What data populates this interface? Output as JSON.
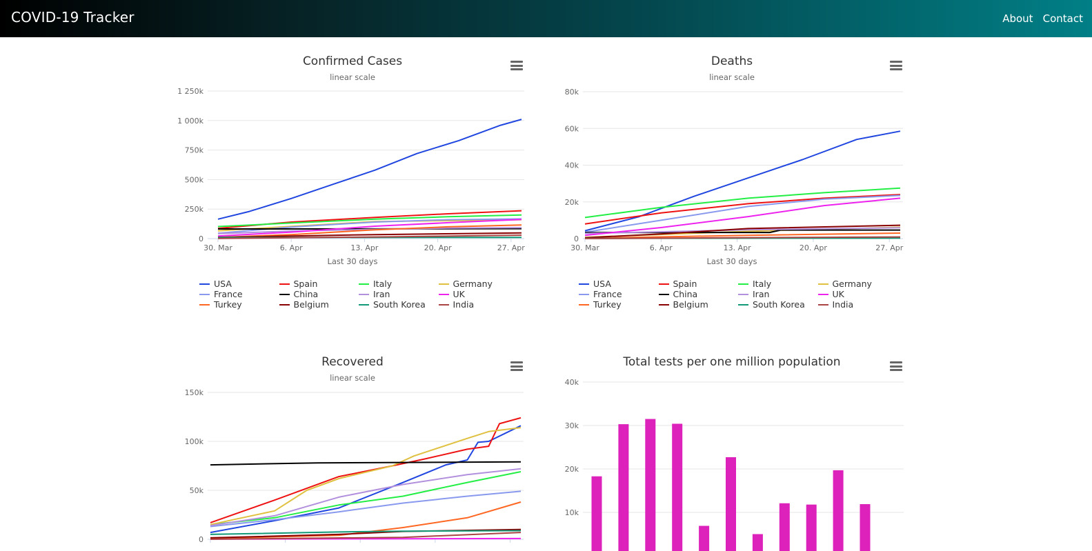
{
  "navbar": {
    "brand": "COVID-19 Tracker",
    "links": [
      "About",
      "Contact"
    ],
    "gradient": [
      "#000000",
      "#017f86"
    ]
  },
  "charts": {
    "confirmed": {
      "title": "Confirmed Cases",
      "subtitle": "linear scale",
      "xlabel": "Last 30 days"
    },
    "deaths": {
      "title": "Deaths",
      "subtitle": "linear scale",
      "xlabel": "Last 30 days"
    },
    "recovered": {
      "title": "Recovered",
      "subtitle": "linear scale"
    },
    "tests": {
      "title": "Total tests per one million population"
    }
  },
  "legend": [
    {
      "name": "USA",
      "color": "#2046e0"
    },
    {
      "name": "Spain",
      "color": "#ee1111"
    },
    {
      "name": "Italy",
      "color": "#22ee44"
    },
    {
      "name": "Germany",
      "color": "#e0c040"
    },
    {
      "name": "France",
      "color": "#8899ee"
    },
    {
      "name": "China",
      "color": "#000000"
    },
    {
      "name": "Iran",
      "color": "#b290dd"
    },
    {
      "name": "UK",
      "color": "#ee22ee"
    },
    {
      "name": "Turkey",
      "color": "#ff6622"
    },
    {
      "name": "Belgium",
      "color": "#880000"
    },
    {
      "name": "South Korea",
      "color": "#119977"
    },
    {
      "name": "India",
      "color": "#aa4444"
    }
  ],
  "chart_data": [
    {
      "type": "line",
      "title": "Confirmed Cases",
      "subtitle": "linear scale",
      "xlabel": "Last 30 days",
      "ylabel": "",
      "x_ticks": [
        "30. Mar",
        "6. Apr",
        "13. Apr",
        "20. Apr",
        "27. Apr"
      ],
      "y_ticks": [
        "0",
        "250k",
        "500k",
        "750k",
        "1 000k",
        "1 250k"
      ],
      "ylim": [
        0,
        1250000
      ],
      "legend_position": "bottom",
      "series": [
        {
          "name": "USA",
          "color": "#2046e0",
          "points": [
            [
              0,
              165000
            ],
            [
              3,
              230000
            ],
            [
              7,
              340000
            ],
            [
              11,
              460000
            ],
            [
              15,
              580000
            ],
            [
              19,
              720000
            ],
            [
              23,
              830000
            ],
            [
              27,
              960000
            ],
            [
              29,
              1010000
            ]
          ]
        },
        {
          "name": "Spain",
          "color": "#ee1111",
          "points": [
            [
              0,
              87000
            ],
            [
              7,
              140000
            ],
            [
              15,
              180000
            ],
            [
              22,
              210000
            ],
            [
              29,
              236000
            ]
          ]
        },
        {
          "name": "Italy",
          "color": "#22ee44",
          "points": [
            [
              0,
              102000
            ],
            [
              7,
              132000
            ],
            [
              15,
              165000
            ],
            [
              22,
              185000
            ],
            [
              29,
              200000
            ]
          ]
        },
        {
          "name": "Germany",
          "color": "#e0c040",
          "points": [
            [
              0,
              66000
            ],
            [
              7,
              104000
            ],
            [
              15,
              145000
            ],
            [
              22,
              152000
            ],
            [
              29,
              160000
            ]
          ]
        },
        {
          "name": "France",
          "color": "#8899ee",
          "points": [
            [
              0,
              45000
            ],
            [
              7,
              98000
            ],
            [
              15,
              140000
            ],
            [
              22,
              160000
            ],
            [
              29,
              167000
            ]
          ]
        },
        {
          "name": "China",
          "color": "#000000",
          "points": [
            [
              0,
              82000
            ],
            [
              29,
              84000
            ]
          ]
        },
        {
          "name": "Iran",
          "color": "#b290dd",
          "points": [
            [
              0,
              42000
            ],
            [
              7,
              64000
            ],
            [
              15,
              79000
            ],
            [
              22,
              89000
            ],
            [
              29,
              93000
            ]
          ]
        },
        {
          "name": "UK",
          "color": "#ee22ee",
          "points": [
            [
              0,
              22000
            ],
            [
              7,
              55000
            ],
            [
              15,
              105000
            ],
            [
              22,
              135000
            ],
            [
              29,
              162000
            ]
          ]
        },
        {
          "name": "Turkey",
          "color": "#ff6622",
          "points": [
            [
              0,
              10000
            ],
            [
              7,
              34000
            ],
            [
              15,
              75000
            ],
            [
              22,
              100000
            ],
            [
              29,
              115000
            ]
          ]
        },
        {
          "name": "Belgium",
          "color": "#880000",
          "points": [
            [
              0,
              11000
            ],
            [
              15,
              34000
            ],
            [
              29,
              48000
            ]
          ]
        },
        {
          "name": "South Korea",
          "color": "#119977",
          "points": [
            [
              0,
              9600
            ],
            [
              29,
              10800
            ]
          ]
        },
        {
          "name": "India",
          "color": "#aa4444",
          "points": [
            [
              0,
              1300
            ],
            [
              15,
              14000
            ],
            [
              29,
              29000
            ]
          ]
        }
      ]
    },
    {
      "type": "line",
      "title": "Deaths",
      "subtitle": "linear scale",
      "xlabel": "Last 30 days",
      "ylabel": "",
      "x_ticks": [
        "30. Mar",
        "6. Apr",
        "13. Apr",
        "20. Apr",
        "27. Apr"
      ],
      "y_ticks": [
        "0",
        "20k",
        "40k",
        "60k",
        "80k"
      ],
      "ylim": [
        0,
        80000
      ],
      "legend_position": "bottom",
      "series": [
        {
          "name": "USA",
          "color": "#2046e0",
          "points": [
            [
              0,
              4300
            ],
            [
              5,
              12000
            ],
            [
              10,
              23000
            ],
            [
              15,
              33000
            ],
            [
              20,
              43000
            ],
            [
              25,
              54000
            ],
            [
              29,
              58500
            ]
          ]
        },
        {
          "name": "Spain",
          "color": "#ee1111",
          "points": [
            [
              0,
              8000
            ],
            [
              7,
              14000
            ],
            [
              15,
              19000
            ],
            [
              22,
              22000
            ],
            [
              29,
              24000
            ]
          ]
        },
        {
          "name": "Italy",
          "color": "#22ee44",
          "points": [
            [
              0,
              11500
            ],
            [
              7,
              17000
            ],
            [
              15,
              22000
            ],
            [
              22,
              25000
            ],
            [
              29,
              27500
            ]
          ]
        },
        {
          "name": "Germany",
          "color": "#e0c040",
          "points": [
            [
              0,
              700
            ],
            [
              15,
              4000
            ],
            [
              29,
              6200
            ]
          ]
        },
        {
          "name": "France",
          "color": "#8899ee",
          "points": [
            [
              0,
              3500
            ],
            [
              7,
              10000
            ],
            [
              15,
              17500
            ],
            [
              22,
              21500
            ],
            [
              29,
              23500
            ]
          ]
        },
        {
          "name": "China",
          "color": "#000000",
          "points": [
            [
              0,
              3300
            ],
            [
              17,
              3350
            ],
            [
              18,
              4640
            ],
            [
              29,
              4640
            ]
          ]
        },
        {
          "name": "Iran",
          "color": "#b290dd",
          "points": [
            [
              0,
              2800
            ],
            [
              15,
              4800
            ],
            [
              29,
              5900
            ]
          ]
        },
        {
          "name": "UK",
          "color": "#ee22ee",
          "points": [
            [
              0,
              1800
            ],
            [
              7,
              6000
            ],
            [
              15,
              12000
            ],
            [
              22,
              18000
            ],
            [
              29,
              22000
            ]
          ]
        },
        {
          "name": "Turkey",
          "color": "#ff6622",
          "points": [
            [
              0,
              170
            ],
            [
              15,
              1800
            ],
            [
              29,
              3000
            ]
          ]
        },
        {
          "name": "Belgium",
          "color": "#880000",
          "points": [
            [
              0,
              500
            ],
            [
              7,
              2500
            ],
            [
              15,
              5500
            ],
            [
              29,
              7300
            ]
          ]
        },
        {
          "name": "South Korea",
          "color": "#119977",
          "points": [
            [
              0,
              160
            ],
            [
              29,
              245
            ]
          ]
        },
        {
          "name": "India",
          "color": "#aa4444",
          "points": [
            [
              0,
              30
            ],
            [
              29,
              900
            ]
          ]
        }
      ]
    },
    {
      "type": "line",
      "title": "Recovered",
      "subtitle": "linear scale",
      "xlabel": "",
      "ylabel": "",
      "y_ticks": [
        "0",
        "50k",
        "100k",
        "150k"
      ],
      "ylim": [
        0,
        150000
      ],
      "series": [
        {
          "name": "USA",
          "color": "#2046e0",
          "points": [
            [
              0,
              7000
            ],
            [
              6,
              19000
            ],
            [
              12,
              32000
            ],
            [
              18,
              58000
            ],
            [
              22,
              76000
            ],
            [
              24,
              81000
            ],
            [
              25,
              99000
            ],
            [
              26,
              100000
            ],
            [
              29,
              116000
            ]
          ]
        },
        {
          "name": "Spain",
          "color": "#ee1111",
          "points": [
            [
              0,
              17000
            ],
            [
              6,
              40000
            ],
            [
              12,
              64000
            ],
            [
              17,
              75000
            ],
            [
              20,
              82000
            ],
            [
              24,
              92000
            ],
            [
              26,
              95000
            ],
            [
              27,
              118000
            ],
            [
              29,
              124000
            ]
          ]
        },
        {
          "name": "Italy",
          "color": "#22ee44",
          "points": [
            [
              0,
              15000
            ],
            [
              6,
              22000
            ],
            [
              12,
              35000
            ],
            [
              18,
              44000
            ],
            [
              24,
              58000
            ],
            [
              29,
              69000
            ]
          ]
        },
        {
          "name": "Germany",
          "color": "#e0c040",
          "points": [
            [
              0,
              15000
            ],
            [
              6,
              29000
            ],
            [
              9,
              50000
            ],
            [
              12,
              62000
            ],
            [
              17,
              75000
            ],
            [
              19,
              85000
            ],
            [
              24,
              103000
            ],
            [
              26,
              110000
            ],
            [
              29,
              114000
            ]
          ]
        },
        {
          "name": "France",
          "color": "#8899ee",
          "points": [
            [
              0,
              13000
            ],
            [
              6,
              20000
            ],
            [
              12,
              28000
            ],
            [
              18,
              37000
            ],
            [
              24,
              44000
            ],
            [
              29,
              49000
            ]
          ]
        },
        {
          "name": "China",
          "color": "#000000",
          "points": [
            [
              0,
              76000
            ],
            [
              10,
              78000
            ],
            [
              29,
              79000
            ]
          ]
        },
        {
          "name": "Iran",
          "color": "#b290dd",
          "points": [
            [
              0,
              14000
            ],
            [
              6,
              24000
            ],
            [
              12,
              43000
            ],
            [
              18,
              56000
            ],
            [
              24,
              66000
            ],
            [
              29,
              72000
            ]
          ]
        },
        {
          "name": "UK",
          "color": "#ee22ee",
          "points": [
            [
              0,
              200
            ],
            [
              29,
              800
            ]
          ]
        },
        {
          "name": "Turkey",
          "color": "#ff6622",
          "points": [
            [
              0,
              1000
            ],
            [
              12,
              4000
            ],
            [
              18,
              12000
            ],
            [
              24,
              22000
            ],
            [
              29,
              38000
            ]
          ]
        },
        {
          "name": "Belgium",
          "color": "#880000",
          "points": [
            [
              0,
              1500
            ],
            [
              12,
              5000
            ],
            [
              18,
              8000
            ],
            [
              29,
              10000
            ]
          ]
        },
        {
          "name": "South Korea",
          "color": "#119977",
          "points": [
            [
              0,
              5000
            ],
            [
              12,
              7500
            ],
            [
              18,
              8300
            ],
            [
              29,
              8800
            ]
          ]
        },
        {
          "name": "India",
          "color": "#aa4444",
          "points": [
            [
              0,
              100
            ],
            [
              18,
              2000
            ],
            [
              29,
              7000
            ]
          ]
        }
      ]
    },
    {
      "type": "bar",
      "title": "Total tests per one million population",
      "y_ticks": [
        "10k",
        "20k",
        "30k",
        "40k"
      ],
      "ylim": [
        0,
        40000
      ],
      "color": "#dd22bb",
      "values": [
        18300,
        30300,
        31500,
        30400,
        6900,
        22700,
        5000,
        12100,
        11800,
        19700,
        11900
      ]
    }
  ]
}
